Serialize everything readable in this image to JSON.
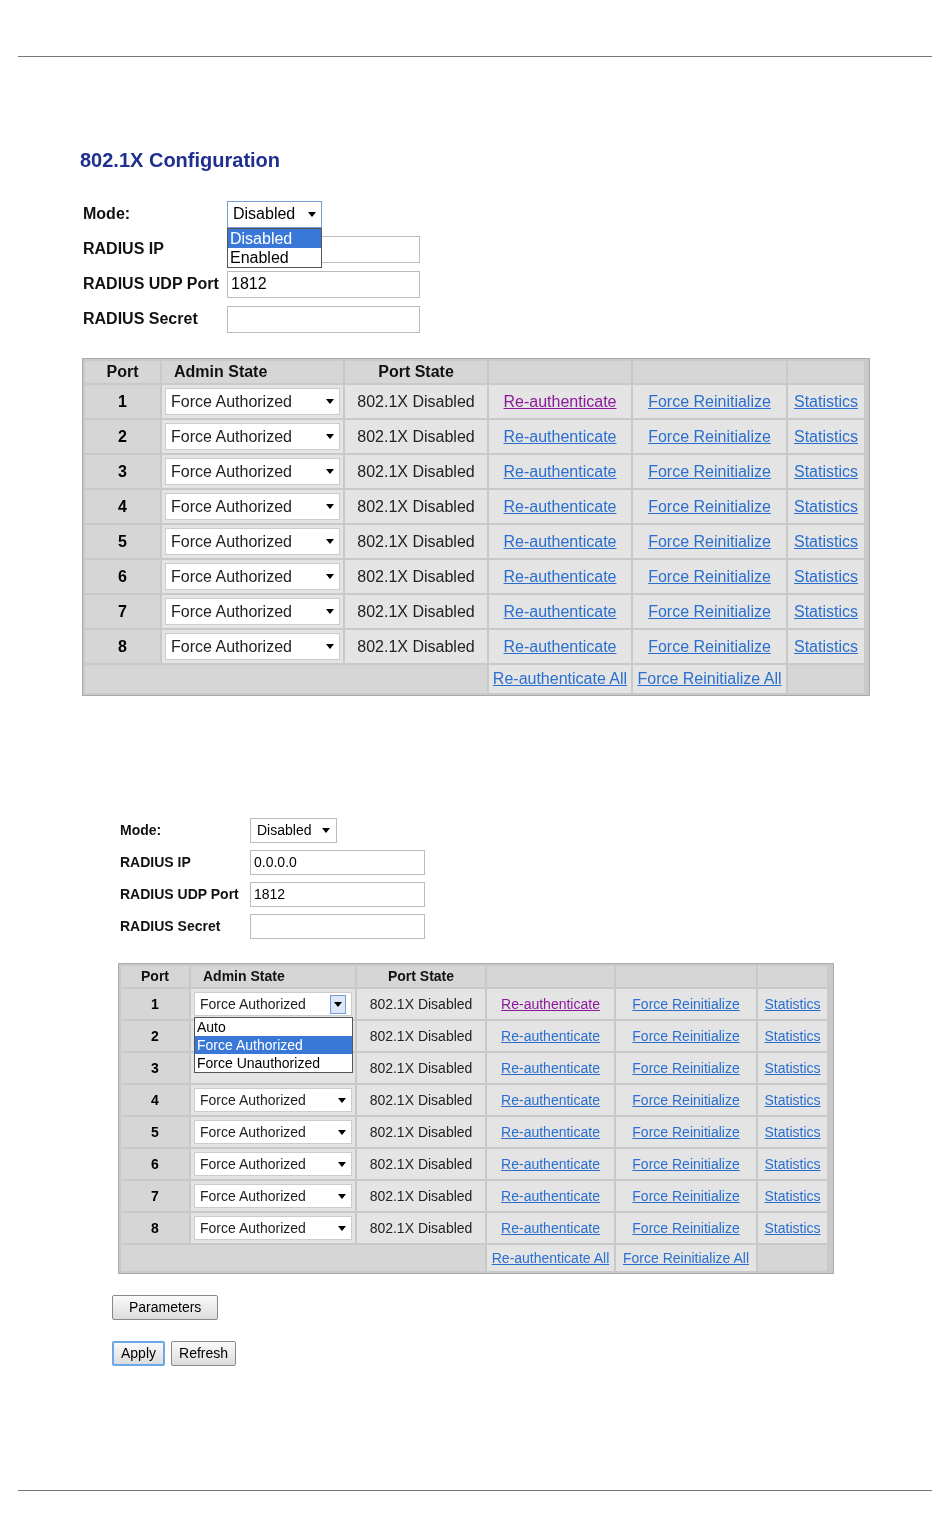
{
  "screenshots": [
    {
      "title": "802.1X Configuration",
      "form": [
        {
          "kind": "select",
          "label": "Mode:",
          "value": "Disabled",
          "options": [
            {
              "label": "Disabled",
              "selected": true
            },
            {
              "label": "Enabled",
              "selected": false
            }
          ]
        },
        {
          "kind": "text",
          "label": "RADIUS IP"
        },
        {
          "kind": "text",
          "label": "RADIUS UDP Port",
          "value": "1812"
        },
        {
          "kind": "text",
          "label": "RADIUS Secret"
        }
      ],
      "table": {
        "columns": [
          "Port",
          "Admin State",
          "Port State"
        ],
        "rows": [
          {
            "port": "1",
            "admin_state": "Force Authorized",
            "port_state": "802.1X Disabled",
            "links": [
              {
                "label": "Re-authenticate",
                "visited": true
              },
              {
                "label": "Force Reinitialize",
                "visited": false
              },
              {
                "label": "Statistics",
                "visited": false
              }
            ]
          },
          {
            "port": "2",
            "admin_state": "Force Authorized",
            "port_state": "802.1X Disabled",
            "links": [
              {
                "label": "Re-authenticate",
                "visited": false
              },
              {
                "label": "Force Reinitialize",
                "visited": false
              },
              {
                "label": "Statistics",
                "visited": false
              }
            ]
          },
          {
            "port": "3",
            "admin_state": "Force Authorized",
            "port_state": "802.1X Disabled",
            "links": [
              {
                "label": "Re-authenticate",
                "visited": false
              },
              {
                "label": "Force Reinitialize",
                "visited": false
              },
              {
                "label": "Statistics",
                "visited": false
              }
            ]
          },
          {
            "port": "4",
            "admin_state": "Force Authorized",
            "port_state": "802.1X Disabled",
            "links": [
              {
                "label": "Re-authenticate",
                "visited": false
              },
              {
                "label": "Force Reinitialize",
                "visited": false
              },
              {
                "label": "Statistics",
                "visited": false
              }
            ]
          },
          {
            "port": "5",
            "admin_state": "Force Authorized",
            "port_state": "802.1X Disabled",
            "links": [
              {
                "label": "Re-authenticate",
                "visited": false
              },
              {
                "label": "Force Reinitialize",
                "visited": false
              },
              {
                "label": "Statistics",
                "visited": false
              }
            ]
          },
          {
            "port": "6",
            "admin_state": "Force Authorized",
            "port_state": "802.1X Disabled",
            "links": [
              {
                "label": "Re-authenticate",
                "visited": false
              },
              {
                "label": "Force Reinitialize",
                "visited": false
              },
              {
                "label": "Statistics",
                "visited": false
              }
            ]
          },
          {
            "port": "7",
            "admin_state": "Force Authorized",
            "port_state": "802.1X Disabled",
            "links": [
              {
                "label": "Re-authenticate",
                "visited": false
              },
              {
                "label": "Force Reinitialize",
                "visited": false
              },
              {
                "label": "Statistics",
                "visited": false
              }
            ]
          },
          {
            "port": "8",
            "admin_state": "Force Authorized",
            "port_state": "802.1X Disabled",
            "links": [
              {
                "label": "Re-authenticate",
                "visited": false
              },
              {
                "label": "Force Reinitialize",
                "visited": false
              },
              {
                "label": "Statistics",
                "visited": false
              }
            ]
          }
        ],
        "footer_links": [
          "Re-authenticate All",
          "Force Reinitialize All"
        ]
      }
    },
    {
      "form": [
        {
          "kind": "select",
          "label": "Mode:",
          "value": "Disabled"
        },
        {
          "kind": "text",
          "label": "RADIUS IP",
          "value": "0.0.0.0"
        },
        {
          "kind": "text",
          "label": "RADIUS UDP Port",
          "value": "1812"
        },
        {
          "kind": "text",
          "label": "RADIUS Secret"
        }
      ],
      "table": {
        "columns": [
          "Port",
          "Admin State",
          "Port State"
        ],
        "rows": [
          {
            "port": "1",
            "admin_state": "Force Authorized",
            "options": [
              {
                "label": "Auto",
                "selected": false
              },
              {
                "label": "Force Authorized",
                "selected": true
              },
              {
                "label": "Force Unauthorized",
                "selected": false
              }
            ],
            "port_state": "802.1X Disabled",
            "links": [
              {
                "label": "Re-authenticate",
                "visited": true
              },
              {
                "label": "Force Reinitialize",
                "visited": false
              },
              {
                "label": "Statistics",
                "visited": false
              }
            ]
          },
          {
            "port": "2",
            "port_state": "802.1X Disabled",
            "links": [
              {
                "label": "Re-authenticate",
                "visited": false
              },
              {
                "label": "Force Reinitialize",
                "visited": false
              },
              {
                "label": "Statistics",
                "visited": false
              }
            ]
          },
          {
            "port": "3",
            "port_state": "802.1X Disabled",
            "links": [
              {
                "label": "Re-authenticate",
                "visited": false
              },
              {
                "label": "Force Reinitialize",
                "visited": false
              },
              {
                "label": "Statistics",
                "visited": false
              }
            ]
          },
          {
            "port": "4",
            "admin_state": "Force Authorized",
            "port_state": "802.1X Disabled",
            "links": [
              {
                "label": "Re-authenticate",
                "visited": false
              },
              {
                "label": "Force Reinitialize",
                "visited": false
              },
              {
                "label": "Statistics",
                "visited": false
              }
            ]
          },
          {
            "port": "5",
            "admin_state": "Force Authorized",
            "port_state": "802.1X Disabled",
            "links": [
              {
                "label": "Re-authenticate",
                "visited": false
              },
              {
                "label": "Force Reinitialize",
                "visited": false
              },
              {
                "label": "Statistics",
                "visited": false
              }
            ]
          },
          {
            "port": "6",
            "admin_state": "Force Authorized",
            "port_state": "802.1X Disabled",
            "links": [
              {
                "label": "Re-authenticate",
                "visited": false
              },
              {
                "label": "Force Reinitialize",
                "visited": false
              },
              {
                "label": "Statistics",
                "visited": false
              }
            ]
          },
          {
            "port": "7",
            "admin_state": "Force Authorized",
            "port_state": "802.1X Disabled",
            "links": [
              {
                "label": "Re-authenticate",
                "visited": false
              },
              {
                "label": "Force Reinitialize",
                "visited": false
              },
              {
                "label": "Statistics",
                "visited": false
              }
            ]
          },
          {
            "port": "8",
            "admin_state": "Force Authorized",
            "port_state": "802.1X Disabled",
            "links": [
              {
                "label": "Re-authenticate",
                "visited": false
              },
              {
                "label": "Force Reinitialize",
                "visited": false
              },
              {
                "label": "Statistics",
                "visited": false
              }
            ]
          }
        ],
        "footer_links": [
          "Re-authenticate All",
          "Force Reinitialize All"
        ]
      },
      "button_rows": [
        {
          "buttons": [
            {
              "label": "Parameters",
              "focused": false
            }
          ]
        },
        {
          "buttons": [
            {
              "label": "Apply",
              "focused": true
            },
            {
              "label": "Refresh",
              "focused": false
            }
          ]
        }
      ]
    }
  ]
}
